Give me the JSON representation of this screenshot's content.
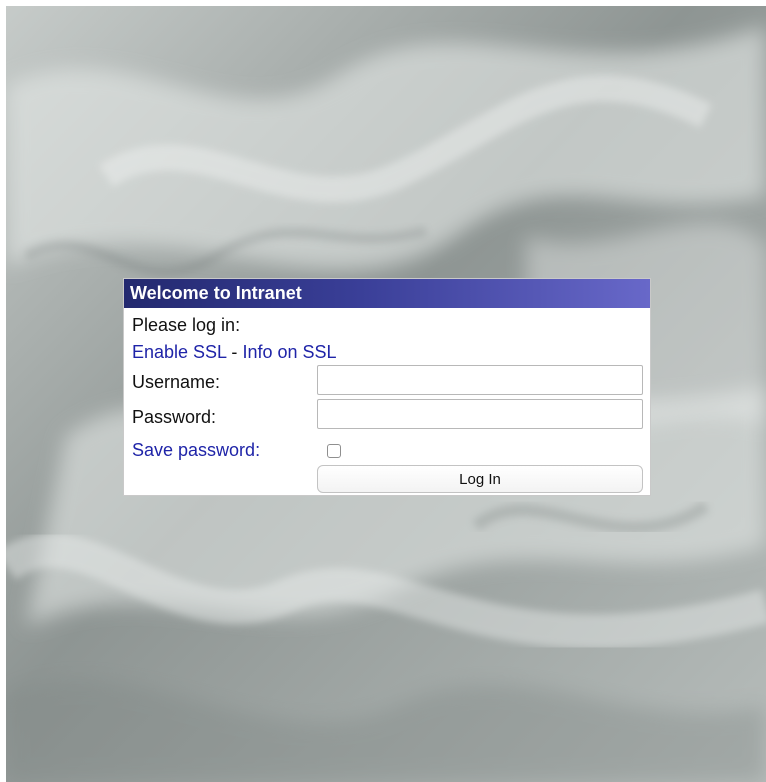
{
  "theme": {
    "header_gradient": [
      "#23296f",
      "#6868c9"
    ],
    "link_color": "#1f24a8",
    "background_tone": "#9da3a1"
  },
  "login": {
    "title": "Welcome to Intranet",
    "prompt": "Please log in:",
    "enable_ssl_link": "Enable SSL",
    "separator": "-",
    "info_ssl_link": "Info on SSL",
    "username_label": "Username:",
    "username_value": "",
    "password_label": "Password:",
    "password_value": "",
    "save_password_label": "Save password:",
    "save_password_checked": false,
    "login_button": "Log In"
  }
}
